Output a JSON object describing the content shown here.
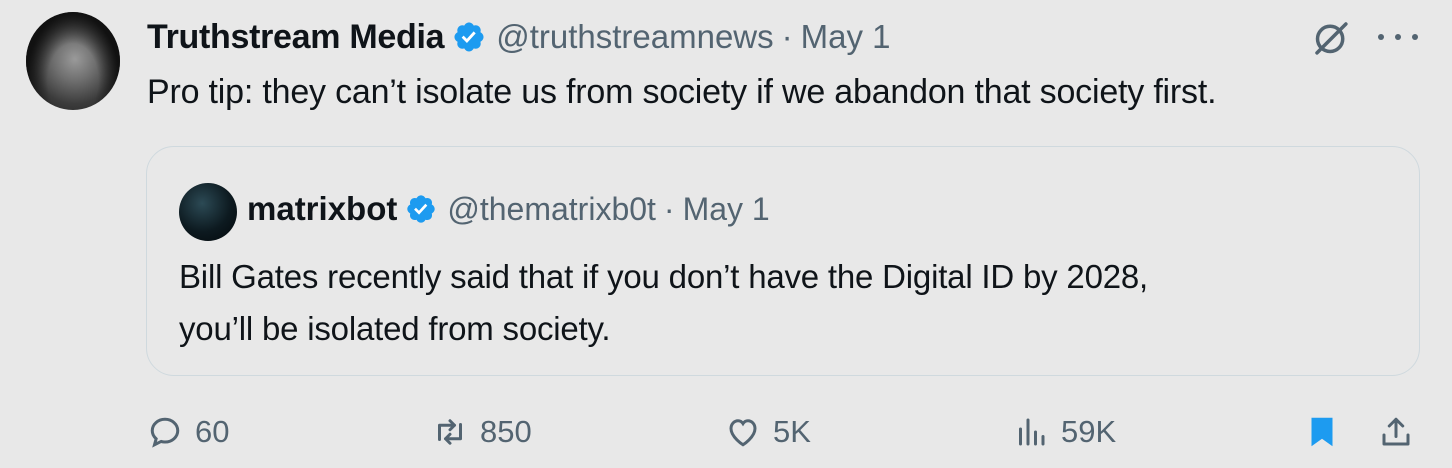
{
  "tweet": {
    "author_name": "Truthstream Media",
    "handle": "@truthstreamnews",
    "separator": "·",
    "date": "May 1",
    "text": "Pro tip: they can’t isolate us from society if we abandon that society first."
  },
  "quoted": {
    "author_name": "matrixbot",
    "handle": "@thematrixb0t",
    "separator": "·",
    "date": "May 1",
    "text_line1": "Bill Gates recently said that if you don’t have the Digital ID by 2028,",
    "text_line2": "you’ll be isolated from society."
  },
  "actions": {
    "replies": "60",
    "reposts": "850",
    "likes": "5K",
    "views": "59K"
  },
  "icons": {
    "verified": "verified-badge-icon",
    "grok": "grok-icon",
    "more": "more-icon",
    "reply": "reply-icon",
    "repost": "repost-icon",
    "like": "heart-icon",
    "views": "views-chart-icon",
    "bookmark": "bookmark-icon",
    "share": "share-icon"
  },
  "colors": {
    "background": "#e8e8e8",
    "text": "#0f1419",
    "secondary": "#536471",
    "verified": "#1d9bf0",
    "bookmark_active": "#1d9bf0",
    "border": "#cfd9de"
  }
}
